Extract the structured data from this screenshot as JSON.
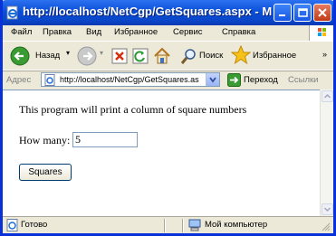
{
  "window": {
    "title": "http://localhost/NetCgp/GetSquares.aspx - Microso"
  },
  "menu": [
    "Файл",
    "Правка",
    "Вид",
    "Избранное",
    "Сервис",
    "Справка"
  ],
  "toolbar": {
    "back_label": "Назад",
    "search_label": "Поиск",
    "favorites_label": "Избранное"
  },
  "address": {
    "label": "Адрес",
    "url": "http://localhost/NetCgp/GetSquares.as",
    "go_label": "Переход",
    "links_label": "Ссылки"
  },
  "page": {
    "intro": "This program will print a column of square numbers",
    "how_many_label": "How many:",
    "how_many_value": "5",
    "button_label": "Squares"
  },
  "status": {
    "text": "Готово",
    "zone": "Мой компьютер"
  },
  "colors": {
    "title_bar": "#0a4fd8",
    "window_border": "#0831d9",
    "chrome": "#ece9d8"
  }
}
